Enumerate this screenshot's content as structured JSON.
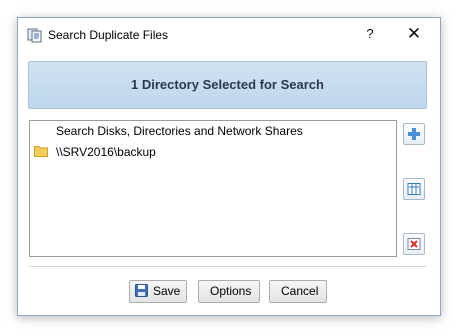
{
  "window": {
    "title": "Search Duplicate Files",
    "help_symbol": "?",
    "close_symbol": "✕"
  },
  "banner": {
    "text": "1 Directory Selected for Search"
  },
  "list": {
    "header": "Search Disks, Directories and Network Shares",
    "items": [
      {
        "label": "\\\\SRV2016\\backup",
        "icon": "folder-icon"
      }
    ]
  },
  "side_buttons": [
    {
      "name": "add-directory-button",
      "icon": "plus-icon"
    },
    {
      "name": "properties-button",
      "icon": "columns-icon"
    },
    {
      "name": "remove-button",
      "icon": "remove-icon"
    }
  ],
  "buttons": {
    "save": "Save",
    "options": "Options",
    "cancel": "Cancel"
  },
  "colors": {
    "banner_bg": "#c6dcef",
    "banner_text": "#2b3b4f",
    "folder": "#f2c94c"
  }
}
